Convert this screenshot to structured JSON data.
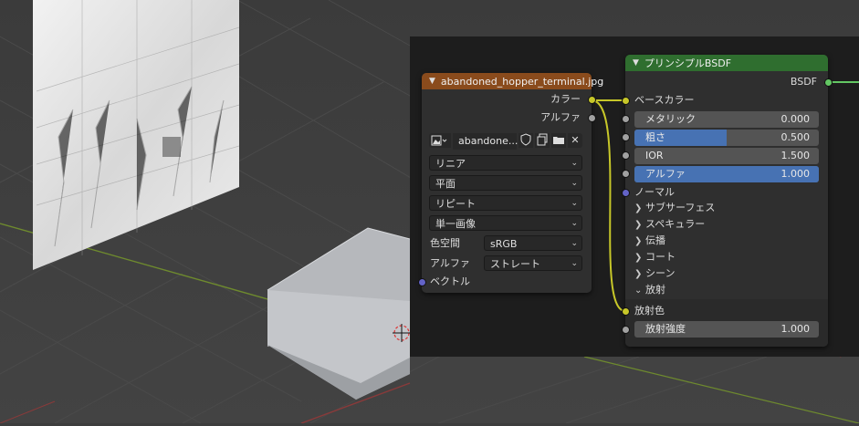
{
  "image_node": {
    "title": "abandoned_hopper_terminal.jpg",
    "outputs": [
      "カラー",
      "アルファ"
    ],
    "image_name": "abandone...",
    "interpolation": "リニア",
    "projection": "平面",
    "extension": "リピート",
    "source": "単一画像",
    "color_space_label": "色空間",
    "color_space": "sRGB",
    "alpha_label": "アルファ",
    "alpha_mode": "ストレート",
    "vector_label": "ベクトル",
    "header_color": "#8a4b1c"
  },
  "bsdf_node": {
    "title": "プリンシプルBSDF",
    "output_label": "BSDF",
    "base_color_label": "ベースカラー",
    "fields": [
      {
        "label": "メタリック",
        "value": "0.000",
        "fill": 0.0
      },
      {
        "label": "粗さ",
        "value": "0.500",
        "fill": 0.5
      },
      {
        "label": "IOR",
        "value": "1.500",
        "fill": 0.0
      },
      {
        "label": "アルファ",
        "value": "1.000",
        "fill": 1.0
      }
    ],
    "normal_label": "ノーマル",
    "panels": [
      {
        "label": "サブサーフェス",
        "expanded": false
      },
      {
        "label": "スペキュラー",
        "expanded": false
      },
      {
        "label": "伝播",
        "expanded": false
      },
      {
        "label": "コート",
        "expanded": false
      },
      {
        "label": "シーン",
        "expanded": false
      },
      {
        "label": "放射",
        "expanded": true
      }
    ],
    "emission_color_label": "放射色",
    "emission_strength": {
      "label": "放射強度",
      "value": "1.000"
    },
    "header_color": "#2f6e2f"
  },
  "colors": {
    "link": "#c7c729",
    "field_accent": "#4772b3"
  }
}
